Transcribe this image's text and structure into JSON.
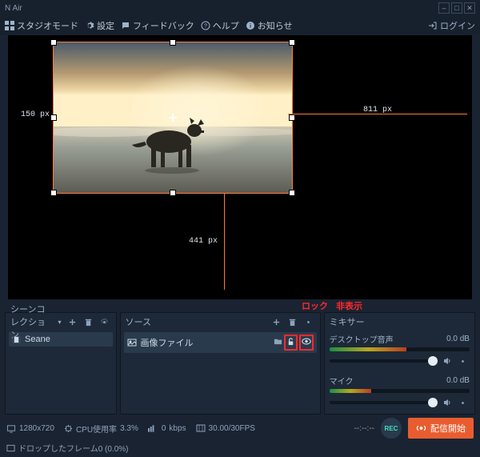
{
  "window": {
    "title": "N Air"
  },
  "menu": {
    "studio_mode": "スタジオモード",
    "settings": "設定",
    "feedback": "フィードバック",
    "help": "ヘルプ",
    "notice": "お知らせ",
    "login": "ログイン"
  },
  "preview": {
    "dim_left": "150 px",
    "dim_right": "811 px",
    "dim_bottom": "441 px"
  },
  "annotation": {
    "lock": "ロック",
    "hide": "非表示"
  },
  "scene_panel": {
    "title": "シーンコレクション",
    "items": [
      "Seane"
    ]
  },
  "source_panel": {
    "title": "ソース",
    "items": [
      {
        "name": "画像ファイル"
      }
    ]
  },
  "mixer": {
    "title": "ミキサー",
    "channels": [
      {
        "name": "デスクトップ音声",
        "db": "0.0 dB"
      },
      {
        "name": "マイク",
        "db": "0.0 dB"
      }
    ]
  },
  "status": {
    "resolution": "1280x720",
    "cpu": {
      "label": "CPU使用率",
      "value": "3.3%"
    },
    "bitrate_label": "kbps",
    "bitrate_icon": "0",
    "fps": "30.00/30FPS",
    "time": "--:--:--",
    "rec": "REC",
    "start": "配信開始",
    "dropped": "ドロップしたフレーム0 (0.0%)"
  }
}
